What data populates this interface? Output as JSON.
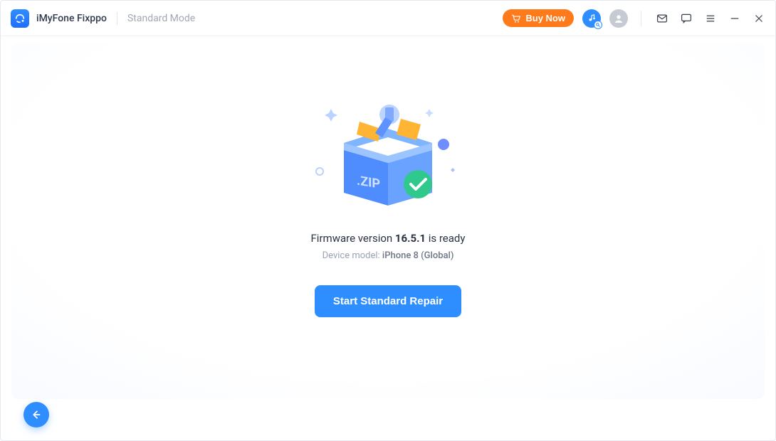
{
  "app": {
    "name": "iMyFone Fixppo",
    "mode": "Standard Mode"
  },
  "header": {
    "buy_now_label": "Buy Now"
  },
  "main": {
    "firmware_prefix": "Firmware version ",
    "firmware_version": "16.5.1",
    "firmware_suffix": " is ready",
    "device_label_prefix": "Device model: ",
    "device_model": "iPhone 8 (Global)",
    "primary_button_label": "Start Standard Repair",
    "illustration_text": ".ZIP"
  },
  "colors": {
    "accent": "#2f8eff",
    "buy_now": "#ff7a1a"
  }
}
